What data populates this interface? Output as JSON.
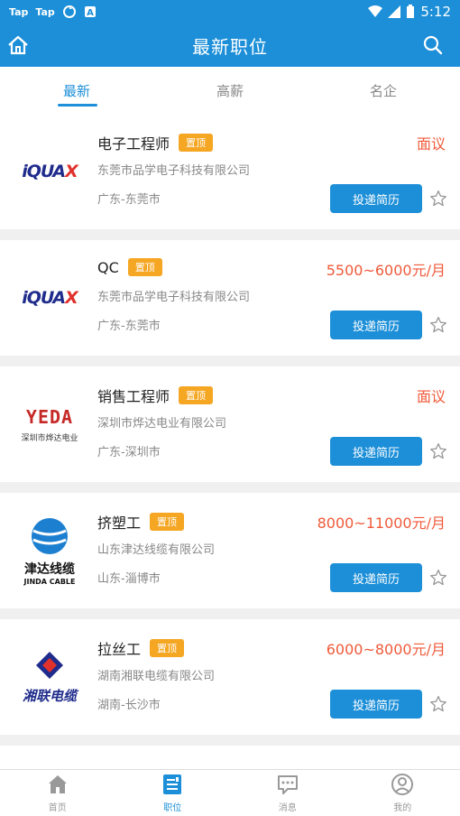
{
  "status_bar": {
    "left_items": [
      "Tap",
      "Tap"
    ],
    "time": "5:12"
  },
  "header": {
    "title": "最新职位"
  },
  "tabs": [
    "最新",
    "高薪",
    "名企"
  ],
  "jobs": [
    {
      "title": "电子工程师",
      "badge": "置顶",
      "salary": "面议",
      "company": "东莞市品学电子科技有限公司",
      "location": "广东-东莞市",
      "apply": "投递简历",
      "logo_text": "iQUAX"
    },
    {
      "title": "QC",
      "badge": "置顶",
      "salary": "5500~6000元/月",
      "company": "东莞市品学电子科技有限公司",
      "location": "广东-东莞市",
      "apply": "投递简历",
      "logo_text": "iQUAX"
    },
    {
      "title": "销售工程师",
      "badge": "置顶",
      "salary": "面议",
      "company": "深圳市烨达电业有限公司",
      "location": "广东-深圳市",
      "apply": "投递简历",
      "logo_text": "YEDA",
      "logo_sub": "深圳市烨达电业"
    },
    {
      "title": "挤塑工",
      "badge": "置顶",
      "salary": "8000~11000元/月",
      "company": "山东津达线缆有限公司",
      "location": "山东-淄博市",
      "apply": "投递简历",
      "logo_text": "津达线缆",
      "logo_sub": "JINDA CABLE"
    },
    {
      "title": "拉丝工",
      "badge": "置顶",
      "salary": "6000~8000元/月",
      "company": "湖南湘联电缆有限公司",
      "location": "湖南-长沙市",
      "apply": "投递简历",
      "logo_text": "湘联电缆"
    }
  ],
  "bottom_nav": [
    {
      "label": "首页",
      "icon": "home-icon",
      "active": false
    },
    {
      "label": "职位",
      "icon": "jobs-icon",
      "active": true
    },
    {
      "label": "消息",
      "icon": "message-icon",
      "active": false
    },
    {
      "label": "我的",
      "icon": "profile-icon",
      "active": false
    }
  ],
  "colors": {
    "primary": "#1c8fd8",
    "accent_badge": "#f5a623",
    "salary": "#f05a3a"
  }
}
